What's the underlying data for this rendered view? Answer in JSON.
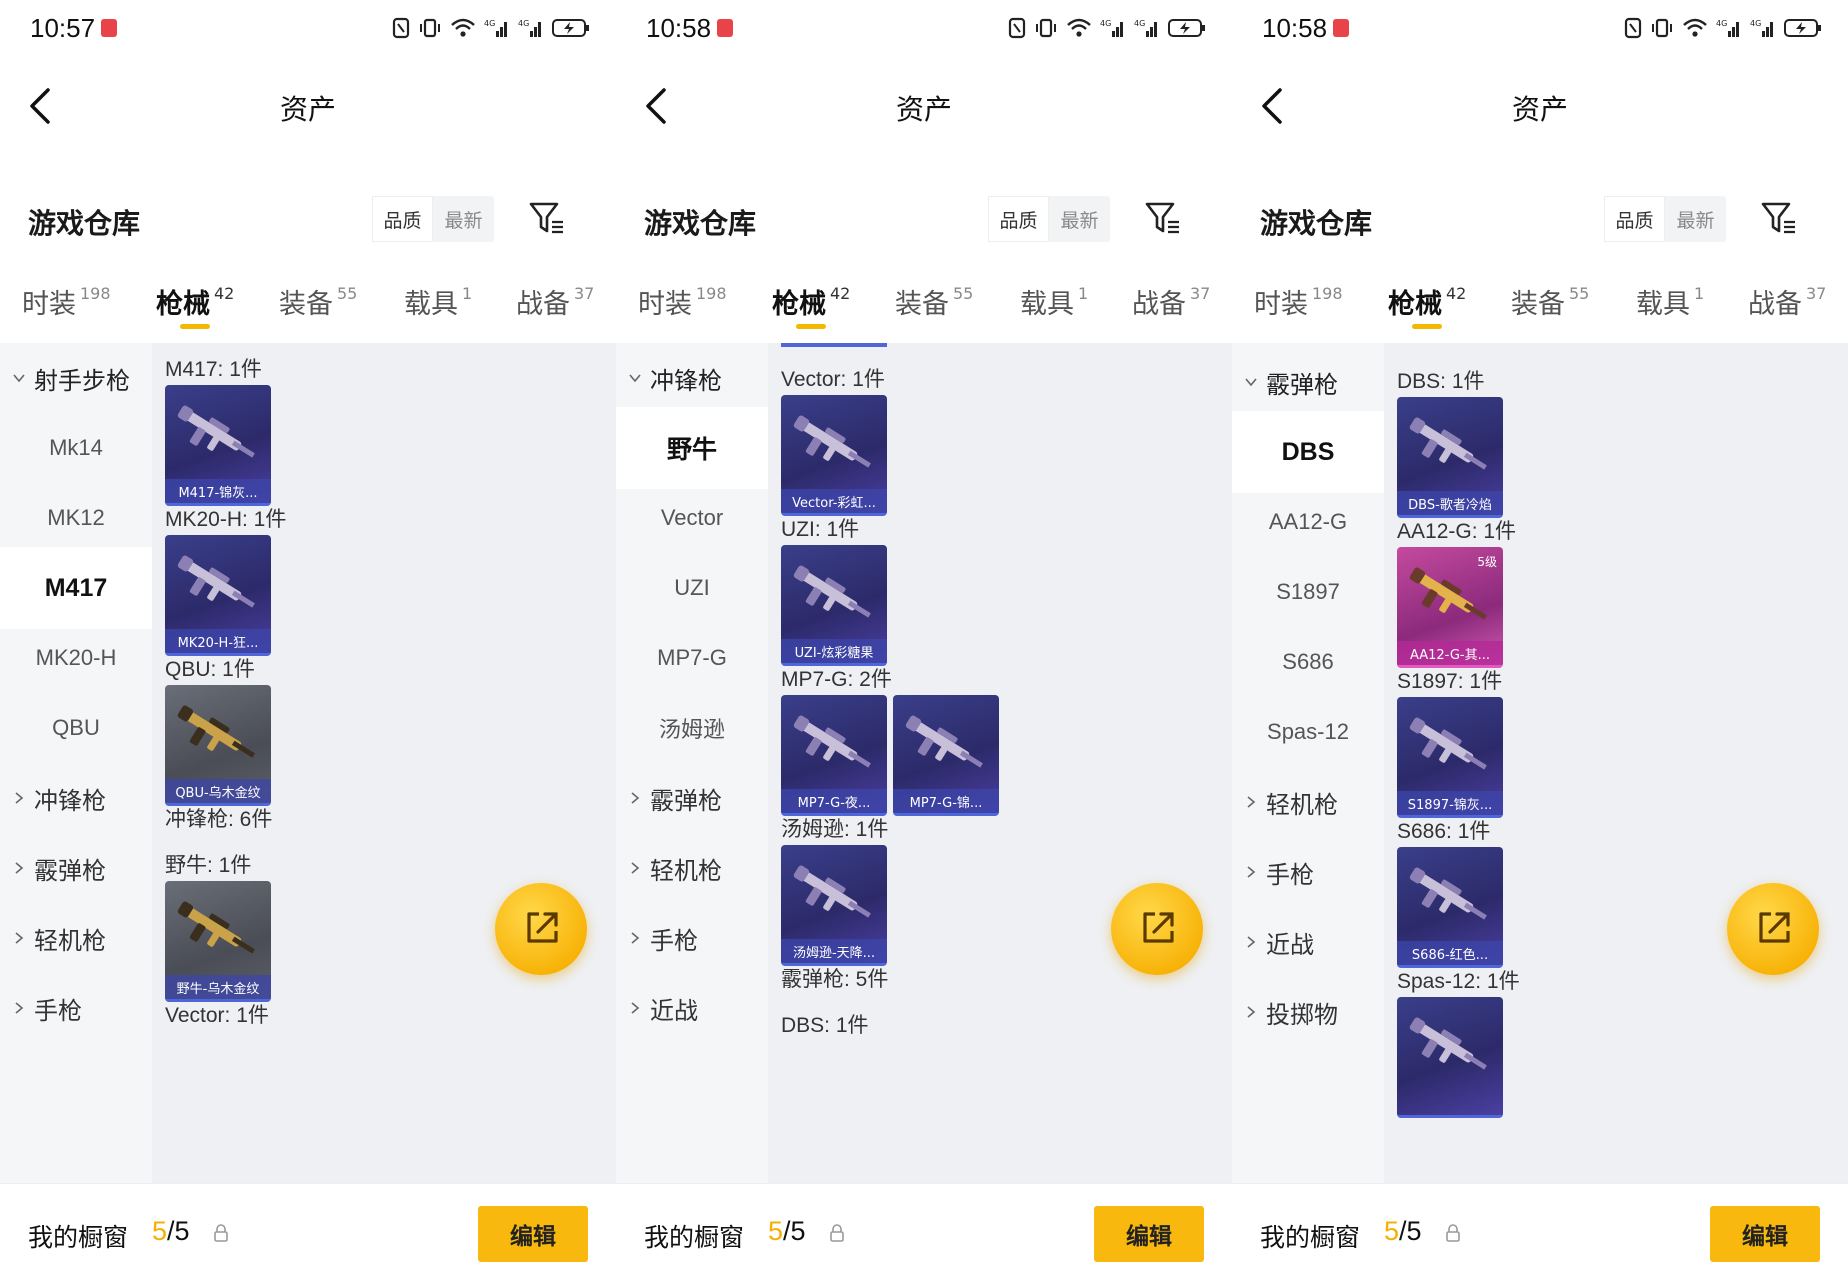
{
  "screens": [
    {
      "time": "10:57",
      "title": "资产",
      "warehouse": "游戏仓库",
      "sort_quality": "品质",
      "sort_newest": "最新",
      "tabs": [
        {
          "label": "时装",
          "count": "198"
        },
        {
          "label": "枪械",
          "count": "42"
        },
        {
          "label": "装备",
          "count": "55"
        },
        {
          "label": "载具",
          "count": "1"
        },
        {
          "label": "战备",
          "count": "37"
        }
      ],
      "sidebar": [
        {
          "label": "射手步枪",
          "kind": "group-open"
        },
        {
          "label": "Mk14",
          "kind": "item"
        },
        {
          "label": "MK12",
          "kind": "item"
        },
        {
          "label": "M417",
          "kind": "selected"
        },
        {
          "label": "MK20-H",
          "kind": "item"
        },
        {
          "label": "QBU",
          "kind": "item"
        },
        {
          "label": "冲锋枪",
          "kind": "group"
        },
        {
          "label": "霰弹枪",
          "kind": "group"
        },
        {
          "label": "轻机枪",
          "kind": "group"
        },
        {
          "label": "手枪",
          "kind": "group"
        }
      ],
      "sections": [
        {
          "title": "M417: 1件",
          "cards": [
            {
              "name": "M417-锦灰...",
              "style": "blue"
            }
          ]
        },
        {
          "title": "MK20-H: 1件",
          "cards": [
            {
              "name": "MK20-H-狂...",
              "style": "blue"
            }
          ]
        },
        {
          "title": "QBU: 1件",
          "cards": [
            {
              "name": "QBU-乌木金纹",
              "style": "gray"
            }
          ]
        },
        {
          "title": "冲锋枪: 6件",
          "cards": []
        },
        {
          "title": "野牛: 1件",
          "cards": [
            {
              "name": "野牛-乌木金纹",
              "style": "gray"
            }
          ]
        },
        {
          "title": "Vector: 1件",
          "cards": []
        }
      ],
      "showcase_label": "我的橱窗",
      "showcase_current": "5",
      "showcase_total": "/5",
      "edit_label": "编辑"
    },
    {
      "time": "10:58",
      "title": "资产",
      "warehouse": "游戏仓库",
      "sort_quality": "品质",
      "sort_newest": "最新",
      "tabs": [
        {
          "label": "时装",
          "count": "198"
        },
        {
          "label": "枪械",
          "count": "42"
        },
        {
          "label": "装备",
          "count": "55"
        },
        {
          "label": "载具",
          "count": "1"
        },
        {
          "label": "战备",
          "count": "37"
        }
      ],
      "sidebar": [
        {
          "label": "冲锋枪",
          "kind": "group-open"
        },
        {
          "label": "野牛",
          "kind": "selected"
        },
        {
          "label": "Vector",
          "kind": "item"
        },
        {
          "label": "UZI",
          "kind": "item"
        },
        {
          "label": "MP7-G",
          "kind": "item"
        },
        {
          "label": "汤姆逊",
          "kind": "item"
        },
        {
          "label": "霰弹枪",
          "kind": "group"
        },
        {
          "label": "轻机枪",
          "kind": "group"
        },
        {
          "label": "手枪",
          "kind": "group"
        },
        {
          "label": "近战",
          "kind": "group"
        }
      ],
      "sections": [
        {
          "title": "Vector: 1件",
          "cards": [
            {
              "name": "Vector-彩虹...",
              "style": "blue"
            }
          ]
        },
        {
          "title": "UZI: 1件",
          "cards": [
            {
              "name": "UZI-炫彩糖果",
              "style": "blue"
            }
          ]
        },
        {
          "title": "MP7-G: 2件",
          "cards": [
            {
              "name": "MP7-G-夜...",
              "style": "blue"
            },
            {
              "name": "MP7-G-锦...",
              "style": "blue"
            }
          ]
        },
        {
          "title": "汤姆逊: 1件",
          "cards": [
            {
              "name": "汤姆逊-天降...",
              "style": "blue"
            }
          ]
        },
        {
          "title": "霰弹枪: 5件",
          "cards": []
        },
        {
          "title": "DBS: 1件",
          "cards": []
        }
      ],
      "showcase_label": "我的橱窗",
      "showcase_current": "5",
      "showcase_total": "/5",
      "edit_label": "编辑"
    },
    {
      "time": "10:58",
      "title": "资产",
      "warehouse": "游戏仓库",
      "sort_quality": "品质",
      "sort_newest": "最新",
      "tabs": [
        {
          "label": "时装",
          "count": "198"
        },
        {
          "label": "枪械",
          "count": "42"
        },
        {
          "label": "装备",
          "count": "55"
        },
        {
          "label": "载具",
          "count": "1"
        },
        {
          "label": "战备",
          "count": "37"
        }
      ],
      "sidebar": [
        {
          "label": "霰弹枪",
          "kind": "group-open"
        },
        {
          "label": "DBS",
          "kind": "selected"
        },
        {
          "label": "AA12-G",
          "kind": "item"
        },
        {
          "label": "S1897",
          "kind": "item"
        },
        {
          "label": "S686",
          "kind": "item"
        },
        {
          "label": "Spas-12",
          "kind": "item"
        },
        {
          "label": "轻机枪",
          "kind": "group"
        },
        {
          "label": "手枪",
          "kind": "group"
        },
        {
          "label": "近战",
          "kind": "group"
        },
        {
          "label": "投掷物",
          "kind": "group"
        }
      ],
      "sections": [
        {
          "title": "DBS: 1件",
          "cards": [
            {
              "name": "DBS-歌者冷焰",
              "style": "blue"
            }
          ]
        },
        {
          "title": "AA12-G: 1件",
          "cards": [
            {
              "name": "AA12-G-其...",
              "style": "pink",
              "level": "5级"
            }
          ]
        },
        {
          "title": "S1897: 1件",
          "cards": [
            {
              "name": "S1897-锦灰...",
              "style": "blue"
            }
          ]
        },
        {
          "title": "S686: 1件",
          "cards": [
            {
              "name": "S686-红色...",
              "style": "blue"
            }
          ]
        },
        {
          "title": "Spas-12: 1件",
          "cards": [
            {
              "name": "",
              "style": "blue"
            }
          ]
        }
      ],
      "showcase_label": "我的橱窗",
      "showcase_current": "5",
      "showcase_total": "/5",
      "edit_label": "编辑"
    }
  ],
  "icons": [
    "back-arrow-icon",
    "filter-icon",
    "share-icon",
    "lock-icon",
    "chevron-down-icon",
    "chevron-right-icon",
    "battery-icon",
    "wifi-icon",
    "signal-icon",
    "vibrate-icon",
    "nfc-icon",
    "record-icon"
  ],
  "colors": {
    "accent": "#f8b80e",
    "tab_underline": "#f5b800",
    "sidebar_bg": "#f5f6f8",
    "content_bg": "#eef0f3",
    "record_red": "#e9434a",
    "card_blue": "#2c2a6a",
    "card_pink": "#c44a9e"
  }
}
